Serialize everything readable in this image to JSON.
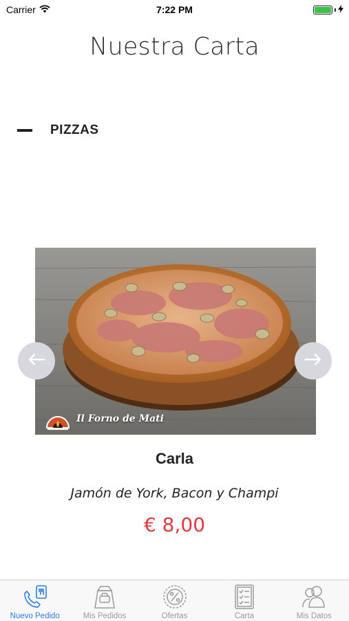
{
  "status_bar": {
    "carrier": "Carrier",
    "time": "7:22 PM",
    "battery_level": 1.0
  },
  "header": {
    "title": "Nuestra Carta"
  },
  "section": {
    "title": "PIZZAS",
    "collapse_icon": "minus-icon"
  },
  "product": {
    "brand": "Il Forno de Mati",
    "name": "Carla",
    "description": "Jamón de York, Bacon y Champi",
    "price": "€ 8,00",
    "price_color": "#e0393e"
  },
  "carousel": {
    "prev_icon": "arrow-left-icon",
    "next_icon": "arrow-right-icon"
  },
  "tab_bar": {
    "active_color": "#2f7de1",
    "tabs": [
      {
        "label": "Nuevo Pedido",
        "icon": "phone-order-icon",
        "active": true
      },
      {
        "label": "Mis Pedidos",
        "icon": "shopping-bag-icon",
        "active": false
      },
      {
        "label": "Ofertas",
        "icon": "percent-badge-icon",
        "active": false
      },
      {
        "label": "Carta",
        "icon": "menu-list-icon",
        "active": false
      },
      {
        "label": "Mis Datos",
        "icon": "users-icon",
        "active": false
      }
    ]
  }
}
